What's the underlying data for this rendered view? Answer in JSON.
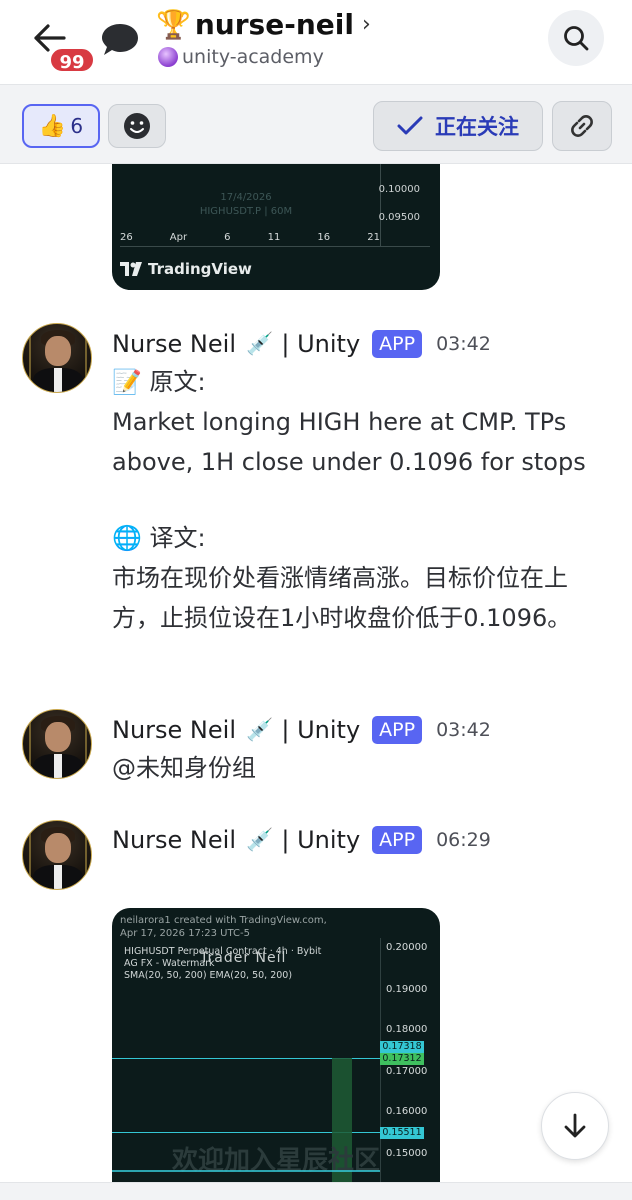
{
  "header": {
    "unread_badge": "99",
    "title": "nurse-neil",
    "subtitle": "unity-academy",
    "icons": [
      "back-arrow-icon",
      "chat-bubble-icon",
      "trophy-icon",
      "chevron-right-icon",
      "crystal-ball-icon",
      "search-icon"
    ]
  },
  "actionbar": {
    "reaction_count": "6",
    "reaction_emoji": "👍",
    "follow_label": "正在关注",
    "icons": [
      "smiley-icon",
      "check-icon",
      "link-icon"
    ]
  },
  "chart_top": {
    "date_watermark": "17/4/2026",
    "symbol_watermark": "HIGHUSDT.P | 60M",
    "price_labels": [
      "0.10000",
      "0.09500"
    ],
    "x_ticks": [
      "26",
      "Apr",
      "6",
      "11",
      "16",
      "21"
    ],
    "brand": "TradingView"
  },
  "messages": [
    {
      "author": "Nurse Neil",
      "author_suffix": "| Unity",
      "tag": "APP",
      "time": "03:42",
      "original_label": "原文:",
      "original_text": "Market longing HIGH here at CMP. TPs above, 1H close under 0.1096 for stops",
      "translation_label": "译文:",
      "translation_text": "市场在现价处看涨情绪高涨。目标价位在上方，止损位设在1小时收盘价低于0.1096。"
    },
    {
      "author": "Nurse Neil",
      "author_suffix": "| Unity",
      "tag": "APP",
      "time": "03:42",
      "text": "@未知身份组"
    },
    {
      "author": "Nurse Neil",
      "author_suffix": "| Unity",
      "tag": "APP",
      "time": "06:29"
    }
  ],
  "chart_bottom": {
    "credit_line1": "neilarora1 created with TradingView.com,",
    "credit_line2": "Apr 17, 2026 17:23 UTC-5",
    "legend_line1": "HIGHUSDT Perpetual Contract · 4h · Bybit",
    "legend_line2": "AG FX - Watermark",
    "legend_line3": "SMA(20, 50, 200) EMA(20, 50, 200)",
    "trader_label": "Trader Neil",
    "price_labels": [
      "0.20000",
      "0.19000",
      "0.18000",
      "0.17000",
      "0.16000",
      "0.15000"
    ],
    "tag_labels": [
      "0.17318",
      "0.17312",
      "0.15511"
    ],
    "watermark_cn": "欢迎加入星辰社区",
    "colors": {
      "cyan": "#34c7d4",
      "green": "#3fbf5f"
    }
  },
  "fab": {
    "icon": "arrow-down-icon"
  },
  "colors": {
    "accent": "#5865f2",
    "badge": "#d83a42"
  }
}
